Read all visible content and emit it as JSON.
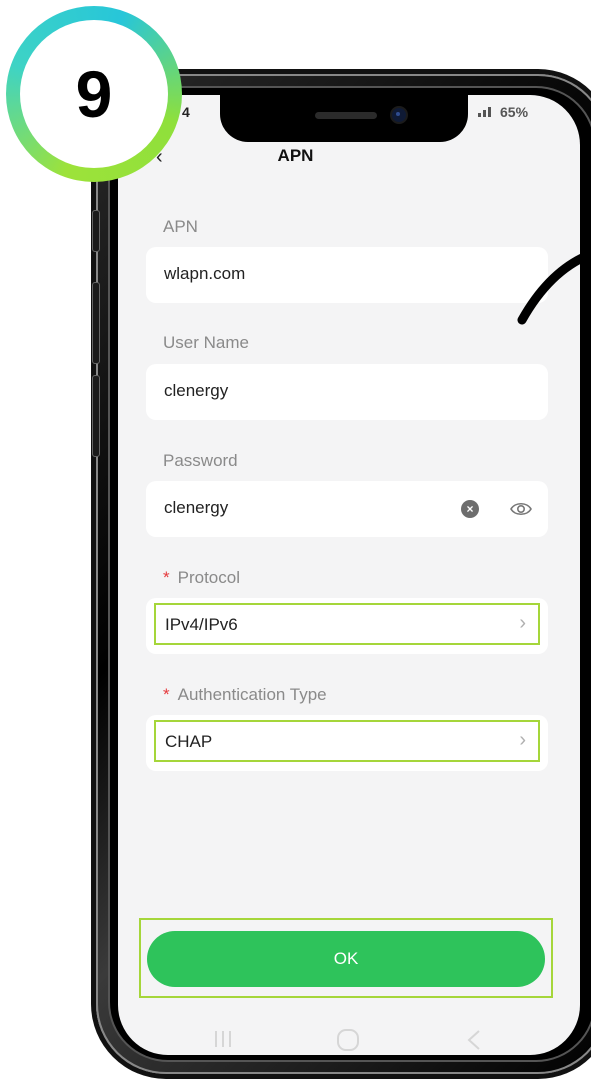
{
  "step_badge": "9",
  "status_bar": {
    "left": "4",
    "battery": "65%"
  },
  "header": {
    "title": "APN",
    "back_icon": "chevron-left-icon"
  },
  "form": {
    "apn": {
      "label": "APN",
      "value": "wlapn.com"
    },
    "username": {
      "label": "User Name",
      "value": "clenergy"
    },
    "password": {
      "label": "Password",
      "value": "clenergy",
      "clear_icon": "clear-icon",
      "visibility_icon": "eye-icon"
    },
    "protocol": {
      "required_mark": "*",
      "label": "Protocol",
      "value": "IPv4/IPv6"
    },
    "auth_type": {
      "required_mark": "*",
      "label": "Authentication Type",
      "value": "CHAP"
    }
  },
  "ok_button": {
    "label": "OK"
  },
  "colors": {
    "accent_green": "#2ec35b",
    "highlight": "#a5d63a",
    "required": "#e5393c"
  }
}
